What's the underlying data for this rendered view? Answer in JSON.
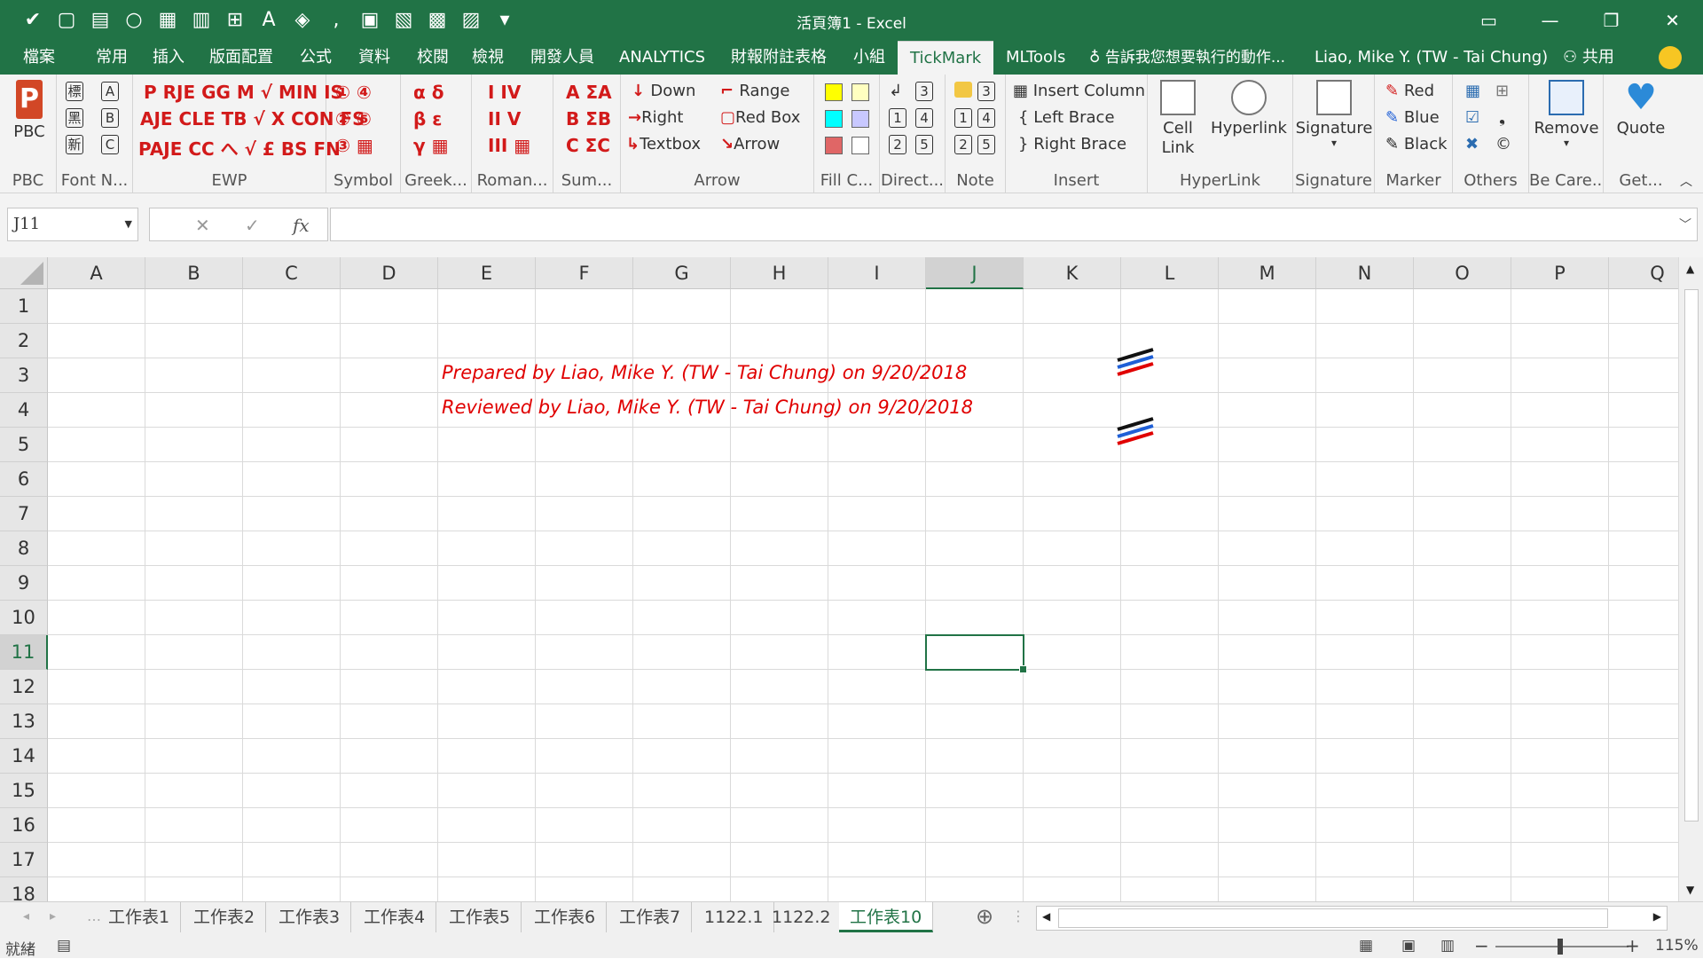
{
  "titlebar": {
    "title": "活頁簿1 - Excel",
    "qat_icons": [
      "tick-icon",
      "save-icon",
      "sheet-icon",
      "circle-icon",
      "table-icon",
      "form-icon",
      "border-icon",
      "font-color-icon",
      "fill-color-icon",
      "comma-icon",
      "screen-icon",
      "edit-icon",
      "grid-icon",
      "list-icon",
      "customize-icon"
    ]
  },
  "menu": {
    "tabs": [
      "檔案",
      "常用",
      "插入",
      "版面配置",
      "公式",
      "資料",
      "校閱",
      "檢視",
      "開發人員",
      "ANALYTICS",
      "財報附註表格",
      "小組",
      "TickMark",
      "MLTools"
    ],
    "active": "TickMark",
    "tellme": "告訴我您想要執行的動作...",
    "user": "Liao, Mike Y. (TW - Tai Chung)",
    "share": "共用"
  },
  "ribbon": {
    "groups": {
      "pbc": "PBC",
      "fontname": "Font N...",
      "ewp": "EWP",
      "symbol": "Symbol",
      "greek": "Greek...",
      "roman": "Roman...",
      "sum": "Sum...",
      "arrow": "Arrow",
      "fill": "Fill C...",
      "direct": "Direct...",
      "note": "Note",
      "insert": "Insert",
      "hyperlink": "HyperLink",
      "signature": "Signature",
      "marker": "Marker",
      "others": "Others",
      "becare": "Be Care...",
      "get": "Get..."
    },
    "pbc_button": "PBC",
    "font_boxes": [
      "A",
      "B",
      "C"
    ],
    "ewp_rows": [
      "P RJE GG M √ MIN IS",
      "AJE CLE TB √ X CON FS",
      "PAJE CC へ √ £ BS FN"
    ],
    "symbol_rows": [
      "① ④",
      "② ⑤",
      "③ ▦"
    ],
    "greek_rows": [
      "α δ",
      "β ε",
      "γ ▦"
    ],
    "roman_rows": [
      "I IV",
      "II V",
      "III ▦"
    ],
    "sum_rows": [
      "A ΣA",
      "B ΣB",
      "C ΣC"
    ],
    "arrow_items": [
      "Down",
      "Right",
      "Textbox",
      "Range",
      "Red Box",
      "Arrow"
    ],
    "direct_boxes": [
      "3",
      "1",
      "4",
      "2",
      "5"
    ],
    "note_boxes": [
      "3",
      "1",
      "4",
      "2",
      "5"
    ],
    "insert_items": [
      "Insert Column",
      "Left Brace",
      "Right Brace"
    ],
    "cell_link": "Cell Link",
    "hyperlink_button": "Hyperlink",
    "signature_button": "Signature",
    "marker_items": [
      "Red",
      "Blue",
      "Black"
    ],
    "remove_button": "Remove",
    "quote_button": "Quote",
    "fill_colors": [
      "#ffff00",
      "#ffffc0",
      "#00ffff",
      "#c8c8ff",
      "#e06666",
      "#ffffff"
    ],
    "marker_colors": {
      "red": "#d21a1a",
      "blue": "#1f5fd6",
      "black": "#222222"
    }
  },
  "formula": {
    "namebox": "J11",
    "cancel": "✕",
    "enter": "✓",
    "fx": "fx",
    "value": ""
  },
  "grid": {
    "columns": [
      "A",
      "B",
      "C",
      "D",
      "E",
      "F",
      "G",
      "H",
      "I",
      "J",
      "K",
      "L",
      "M",
      "N",
      "O",
      "P",
      "Q"
    ],
    "rows": [
      "1",
      "2",
      "3",
      "4",
      "5",
      "6",
      "7",
      "8",
      "9",
      "10",
      "11",
      "12",
      "13",
      "14",
      "15",
      "16",
      "17",
      "18"
    ],
    "selected_col": "J",
    "selected_row": "11",
    "prepared": "Prepared by Liao, Mike Y. (TW - Tai Chung) on 9/20/2018",
    "reviewed": "Reviewed by Liao, Mike Y. (TW - Tai Chung) on 9/20/2018",
    "text_color": "#e00000"
  },
  "sheets": {
    "tabs": [
      "工作表1",
      "工作表2",
      "工作表3",
      "工作表4",
      "工作表5",
      "工作表6",
      "工作表7",
      "1122.1",
      "1122.2",
      "工作表10"
    ],
    "active": "工作表10",
    "add": "⊕"
  },
  "status": {
    "ready": "就緒",
    "zoom": "115%"
  }
}
